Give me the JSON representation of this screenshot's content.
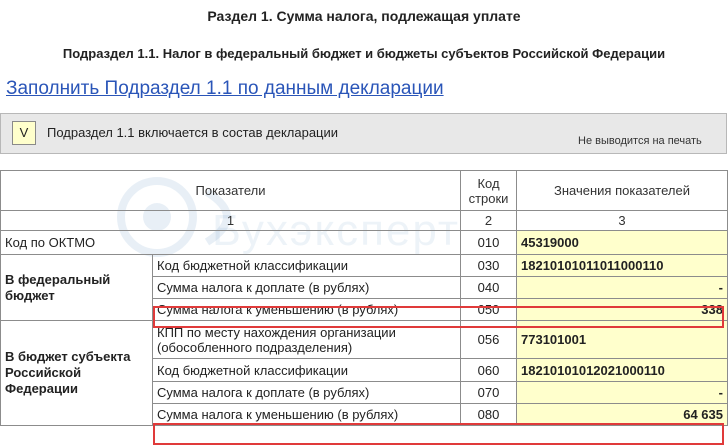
{
  "section_title": "Раздел 1. Сумма налога, подлежащая уплате",
  "subsection_title": "Подраздел 1.1. Налог в федеральный бюджет и бюджеты субъектов Российской Федерации",
  "fill_link": "Заполнить Подраздел 1.1 по данным декларации",
  "include": {
    "checkbox_mark": "V",
    "label": "Подраздел 1.1 включается в состав декларации",
    "no_print": "Не выводится на печать"
  },
  "table": {
    "headers": {
      "indicators": "Показатели",
      "line_code": "Код строки",
      "values": "Значения показателей"
    },
    "col_numbers": [
      "1",
      "2",
      "3"
    ],
    "oktmo": {
      "label": "Код по ОКТМО",
      "code": "010",
      "value": "45319000"
    },
    "federal": {
      "group": "В федеральный бюджет",
      "rows": [
        {
          "label": "Код бюджетной классификации",
          "code": "030",
          "value": "18210101011011000110"
        },
        {
          "label": "Сумма налога к доплате (в рублях)",
          "code": "040",
          "value": "-"
        },
        {
          "label": "Сумма налога к уменьшению (в рублях)",
          "code": "050",
          "value": "338"
        }
      ]
    },
    "regional": {
      "group": "В бюджет субъекта Российской Федерации",
      "rows": [
        {
          "label": "КПП по месту нахождения организации (обособленного подразделения)",
          "code": "056",
          "value": "773101001"
        },
        {
          "label": "Код бюджетной классификации",
          "code": "060",
          "value": "18210101012021000110"
        },
        {
          "label": "Сумма налога к доплате (в рублях)",
          "code": "070",
          "value": "-"
        },
        {
          "label": "Сумма налога к уменьшению (в рублях)",
          "code": "080",
          "value": "64 635"
        }
      ]
    }
  },
  "watermark_text": "Бухэксперт",
  "colors": {
    "link": "#2a55b8",
    "input_fill": "#ffffcc",
    "highlight": "#e03a3a"
  }
}
